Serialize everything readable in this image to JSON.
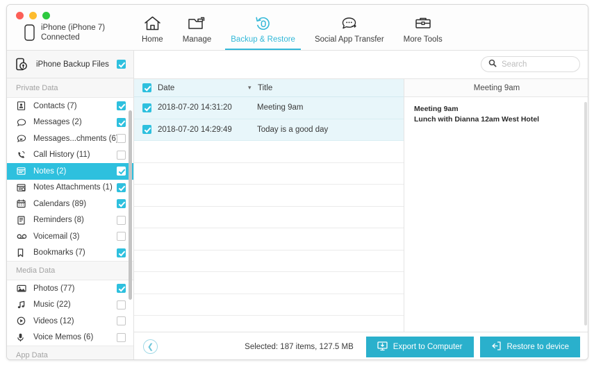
{
  "window": {
    "traffic_lights": [
      "close",
      "minimize",
      "maximize"
    ],
    "device_name": "iPhone (iPhone 7)",
    "device_status": "Connected"
  },
  "nav": {
    "items": [
      {
        "label": "Home",
        "icon": "home-icon",
        "active": false
      },
      {
        "label": "Manage",
        "icon": "folder-icon",
        "active": false
      },
      {
        "label": "Backup & Restore",
        "icon": "restore-circle-icon",
        "active": true
      },
      {
        "label": "Social App Transfer",
        "icon": "chat-transfer-icon",
        "active": false
      },
      {
        "label": "More Tools",
        "icon": "toolbox-icon",
        "active": false
      }
    ]
  },
  "sidebar": {
    "header": {
      "label": "iPhone Backup Files",
      "icon": "backup-lock-icon",
      "checked": true
    },
    "sections": [
      {
        "title": "Private Data",
        "items": [
          {
            "label": "Contacts (7)",
            "icon": "contact-card-icon",
            "checked": true,
            "selected": false
          },
          {
            "label": "Messages (2)",
            "icon": "message-bubble-icon",
            "checked": true,
            "selected": false
          },
          {
            "label": "Messages...chments (6)",
            "icon": "message-attachment-icon",
            "checked": false,
            "selected": false
          },
          {
            "label": "Call History (11)",
            "icon": "phone-call-icon",
            "checked": false,
            "selected": false
          },
          {
            "label": "Notes (2)",
            "icon": "notes-icon",
            "checked": true,
            "selected": true
          },
          {
            "label": "Notes Attachments (1)",
            "icon": "notes-attachment-icon",
            "checked": true,
            "selected": false
          },
          {
            "label": "Calendars (89)",
            "icon": "calendar-icon",
            "checked": true,
            "selected": false
          },
          {
            "label": "Reminders (8)",
            "icon": "reminders-icon",
            "checked": false,
            "selected": false
          },
          {
            "label": "Voicemail (3)",
            "icon": "voicemail-icon",
            "checked": false,
            "selected": false
          },
          {
            "label": "Bookmarks (7)",
            "icon": "bookmark-icon",
            "checked": true,
            "selected": false
          }
        ]
      },
      {
        "title": "Media Data",
        "items": [
          {
            "label": "Photos (77)",
            "icon": "photo-icon",
            "checked": true,
            "selected": false
          },
          {
            "label": "Music (22)",
            "icon": "music-note-icon",
            "checked": false,
            "selected": false
          },
          {
            "label": "Videos (12)",
            "icon": "video-play-icon",
            "checked": false,
            "selected": false
          },
          {
            "label": "Voice Memos (6)",
            "icon": "microphone-icon",
            "checked": false,
            "selected": false
          }
        ]
      },
      {
        "title": "App Data",
        "items": []
      }
    ]
  },
  "toolbar": {
    "search_placeholder": "Search",
    "search_value": "",
    "search_icon": "search-icon"
  },
  "table": {
    "header_checked": true,
    "columns": {
      "date": "Date",
      "title": "Title",
      "sort_indicator": "chevron-down-icon"
    },
    "rows": [
      {
        "checked": true,
        "date": "2018-07-20 14:31:20",
        "title": "Meeting 9am"
      },
      {
        "checked": true,
        "date": "2018-07-20 14:29:49",
        "title": "Today is a good day"
      }
    ],
    "empty_row_count": 9
  },
  "preview": {
    "title": "Meeting 9am",
    "line1": "Meeting 9am",
    "line2": "Lunch with Dianna 12am West Hotel"
  },
  "footer": {
    "back_icon": "chevron-left-icon",
    "selection_summary": "Selected: 187 items, 127.5 MB",
    "export_label": "Export to Computer",
    "export_icon": "export-to-computer-icon",
    "restore_label": "Restore to device",
    "restore_icon": "restore-to-device-icon"
  },
  "colors": {
    "accent": "#2ec0de",
    "accent_button": "#2ab0cc",
    "nav_active": "#32b8d8",
    "row_highlight": "#e8f6fa",
    "traffic_red": "#fc5f57",
    "traffic_yellow": "#fdbc2e",
    "traffic_green": "#2dc93f"
  }
}
